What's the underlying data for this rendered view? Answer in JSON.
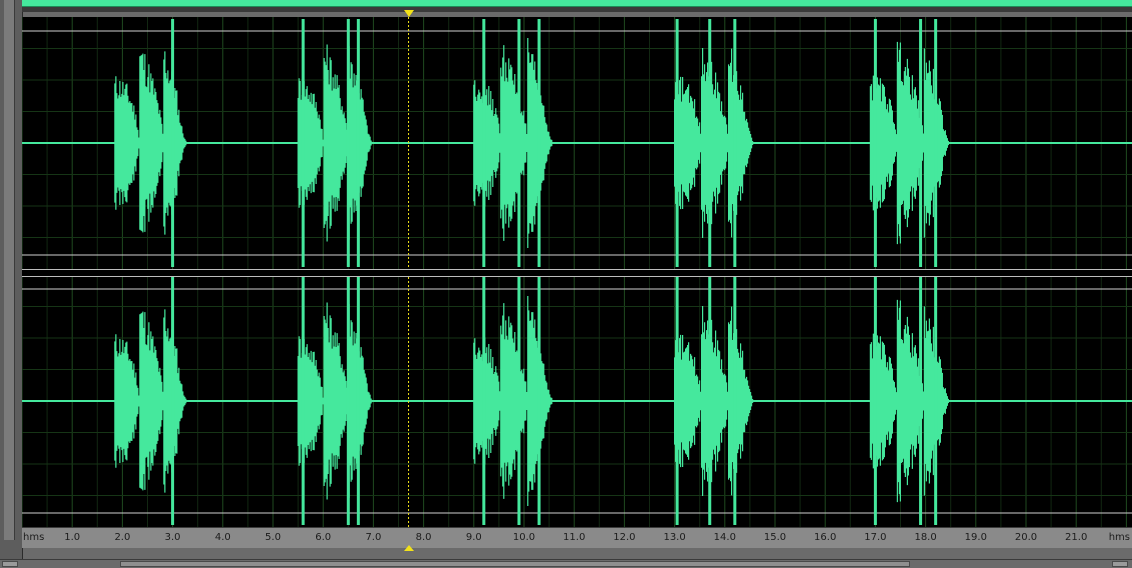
{
  "colors": {
    "waveform": "#45e89d",
    "background": "#000000",
    "grid": "#1f4a1f",
    "clip_line": "#cfcfcf",
    "playhead": "#f2e21a",
    "ruler_bg": "#8a8a8a"
  },
  "icons": {
    "playhead_top": "triangle-down-icon",
    "playhead_bottom": "triangle-up-icon"
  },
  "editor": {
    "channels": [
      "left",
      "right"
    ],
    "playhead_time_s": 7.7,
    "view_start_s": 0.0,
    "view_end_s": 22.0
  },
  "ruler": {
    "unit_left": "hms",
    "unit_right": "hms",
    "ticks": [
      {
        "t": 1.0,
        "label": "1.0"
      },
      {
        "t": 2.0,
        "label": "2.0"
      },
      {
        "t": 3.0,
        "label": "3.0"
      },
      {
        "t": 4.0,
        "label": "4.0"
      },
      {
        "t": 5.0,
        "label": "5.0"
      },
      {
        "t": 6.0,
        "label": "6.0"
      },
      {
        "t": 7.0,
        "label": "7.0"
      },
      {
        "t": 8.0,
        "label": "8.0"
      },
      {
        "t": 9.0,
        "label": "9.0"
      },
      {
        "t": 10.0,
        "label": "10.0"
      },
      {
        "t": 11.0,
        "label": "11.0"
      },
      {
        "t": 12.0,
        "label": "12.0"
      },
      {
        "t": 13.0,
        "label": "13.0"
      },
      {
        "t": 14.0,
        "label": "14.0"
      },
      {
        "t": 15.0,
        "label": "15.0"
      },
      {
        "t": 16.0,
        "label": "16.0"
      },
      {
        "t": 17.0,
        "label": "17.0"
      },
      {
        "t": 18.0,
        "label": "18.0"
      },
      {
        "t": 19.0,
        "label": "19.0"
      },
      {
        "t": 20.0,
        "label": "20.0"
      },
      {
        "t": 21.0,
        "label": "21.0"
      }
    ]
  },
  "bursts_s": [
    {
      "start": 1.85,
      "end": 3.3,
      "spikes": [
        3.0
      ]
    },
    {
      "start": 5.5,
      "end": 7.0,
      "spikes": [
        5.6,
        6.5,
        6.7
      ]
    },
    {
      "start": 9.0,
      "end": 10.6,
      "spikes": [
        9.2,
        9.9,
        10.3
      ]
    },
    {
      "start": 13.0,
      "end": 14.6,
      "spikes": [
        13.05,
        13.7,
        14.2
      ]
    },
    {
      "start": 16.9,
      "end": 18.5,
      "spikes": [
        17.0,
        17.9,
        18.2
      ]
    }
  ]
}
